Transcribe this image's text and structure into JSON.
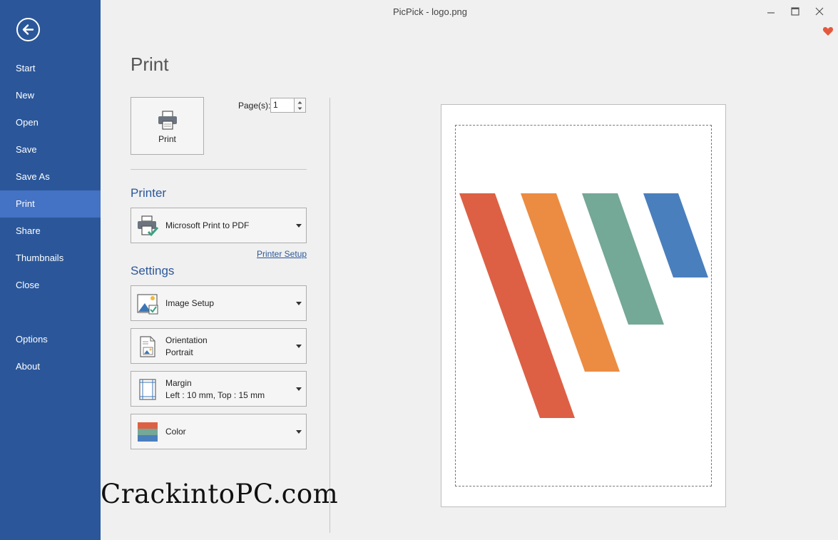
{
  "window": {
    "title": "PicPick - logo.png"
  },
  "sidebar": {
    "items": [
      {
        "label": "Start"
      },
      {
        "label": "New"
      },
      {
        "label": "Open"
      },
      {
        "label": "Save"
      },
      {
        "label": "Save As"
      },
      {
        "label": "Print"
      },
      {
        "label": "Share"
      },
      {
        "label": "Thumbnails"
      },
      {
        "label": "Close"
      },
      {
        "label": "Options"
      },
      {
        "label": "About"
      }
    ],
    "active_item": "Print"
  },
  "main": {
    "title": "Print",
    "print_button_label": "Print",
    "pages_label": "Page(s):",
    "pages_value": "1",
    "printer": {
      "section_title": "Printer",
      "selected": "Microsoft Print to PDF",
      "setup_link": "Printer Setup"
    },
    "settings": {
      "section_title": "Settings",
      "image_setup": "Image Setup",
      "orientation_label": "Orientation",
      "orientation_value": "Portrait",
      "margin_label": "Margin",
      "margin_value": "Left : 10 mm, Top : 15 mm",
      "color_label": "Color"
    }
  },
  "preview": {
    "logo_colors": [
      "#dd6044",
      "#eb8c42",
      "#74a897",
      "#4a7fbd"
    ]
  },
  "watermark": "CrackintoPC.com",
  "colors": {
    "sidebar_bg": "#2b579a",
    "sidebar_active": "#4472c4",
    "accent": "#2b579a",
    "heart": "#e4593c"
  }
}
